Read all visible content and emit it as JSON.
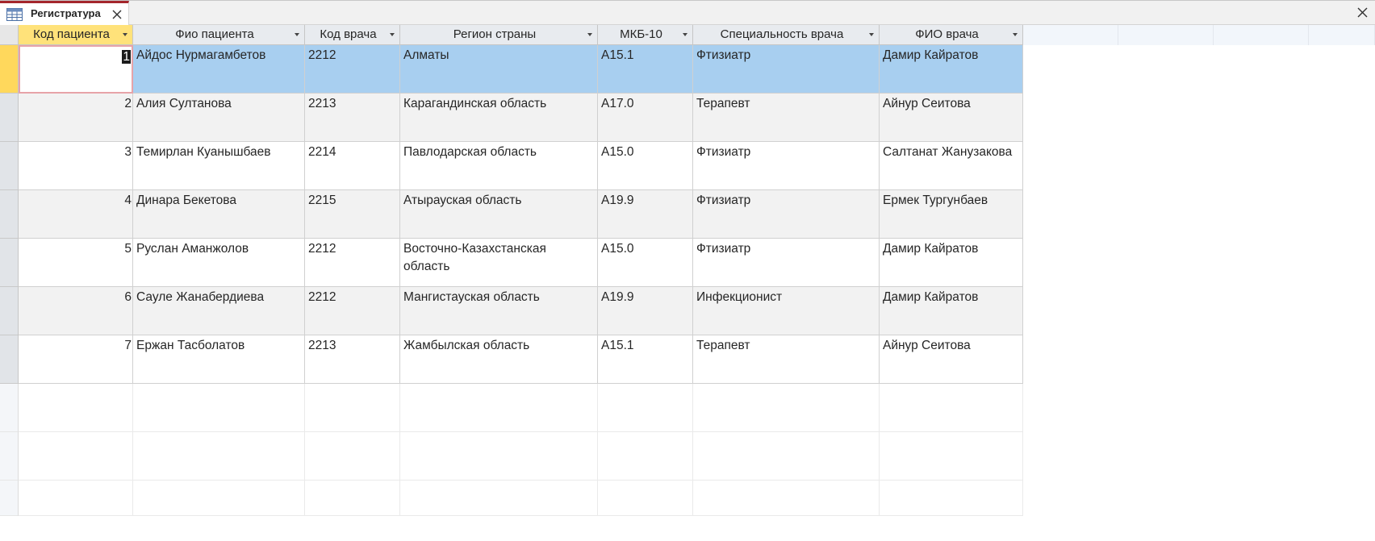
{
  "tab": {
    "title": "Регистратура",
    "icon": "table-icon",
    "close_icon": "close-icon"
  },
  "window": {
    "close_icon": "close-icon"
  },
  "table": {
    "columns": [
      {
        "label": "Код пациента",
        "selected": true
      },
      {
        "label": "Фио пациента"
      },
      {
        "label": "Код врача"
      },
      {
        "label": "Регион страны"
      },
      {
        "label": "МКБ-10"
      },
      {
        "label": "Специальность врача"
      },
      {
        "label": "ФИО врача"
      }
    ],
    "rows": [
      {
        "id": "1",
        "patient": "Айдос Нурмагамбетов",
        "doctor_code": "2212",
        "region": "Алматы",
        "icd10": "A15.1",
        "specialty": "Фтизиатр",
        "doctor": "Дамир Кайратов"
      },
      {
        "id": "2",
        "patient": "Алия Султанова",
        "doctor_code": "2213",
        "region": "Карагандинская область",
        "icd10": "A17.0",
        "specialty": "Терапевт",
        "doctor": "Айнур Сеитова"
      },
      {
        "id": "3",
        "patient": "Темирлан Куанышбаев",
        "doctor_code": "2214",
        "region": "Павлодарская область",
        "icd10": "A15.0",
        "specialty": "Фтизиатр",
        "doctor": "Салтанат Жанузакова"
      },
      {
        "id": "4",
        "patient": "Динара Бекетова",
        "doctor_code": "2215",
        "region": "Атырауская область",
        "icd10": "A19.9",
        "specialty": "Фтизиатр",
        "doctor": "Ермек Тургунбаев"
      },
      {
        "id": "5",
        "patient": "Руслан Аманжолов",
        "doctor_code": "2212",
        "region": "Восточно-Казахстанская область",
        "icd10": "A15.0",
        "specialty": "Фтизиатр",
        "doctor": "Дамир Кайратов"
      },
      {
        "id": "6",
        "patient": "Сауле Жанабердиева",
        "doctor_code": "2212",
        "region": "Мангистауская область",
        "icd10": "A19.9",
        "specialty": "Инфекционист",
        "doctor": "Дамир Кайратов"
      },
      {
        "id": "7",
        "patient": "Ержан Тасболатов",
        "doctor_code": "2213",
        "region": "Жамбылская область",
        "icd10": "A15.1",
        "specialty": "Терапевт",
        "doctor": "Айнур Сеитова"
      }
    ],
    "current_row": "1"
  },
  "colors": {
    "tab_accent": "#a4262c",
    "row_highlight": "#a8cff0",
    "selected_header": "#ffe27a"
  }
}
